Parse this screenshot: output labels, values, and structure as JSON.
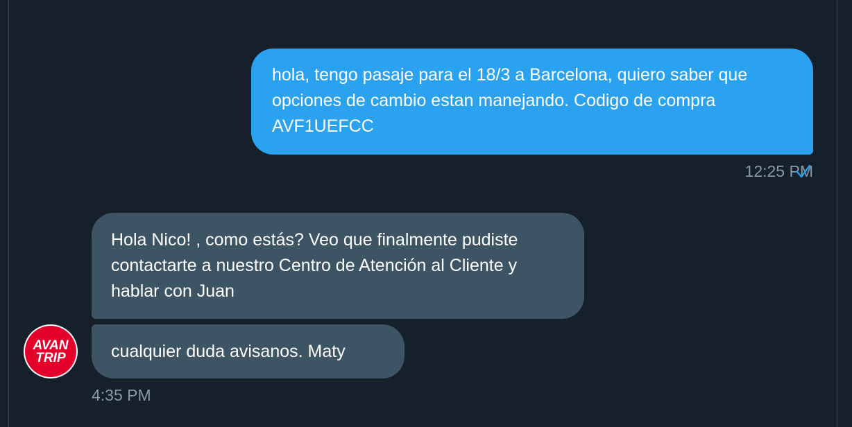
{
  "conversation": {
    "sent": {
      "text": "hola, tengo pasaje para el 18/3 a Barcelona, quiero saber que opciones de cambio estan manejando. Codigo de compra AVF1UEFCC",
      "time": "12:25 PM",
      "status_icon": "check-icon"
    },
    "received": {
      "messages": [
        "Hola Nico! , como estás? Veo que finalmente pudiste contactarte a nuestro Centro de Atención al Cliente y hablar con Juan",
        "cualquier duda avisanos. Maty"
      ],
      "time": "4:35 PM",
      "avatar": {
        "line1": "AVAN",
        "line2": "TRIP",
        "color": "#e4002b"
      }
    }
  },
  "colors": {
    "background": "#15202b",
    "sent_bubble": "#2aa2f0",
    "received_bubble": "#3d5465",
    "meta_text": "#8899a6"
  }
}
